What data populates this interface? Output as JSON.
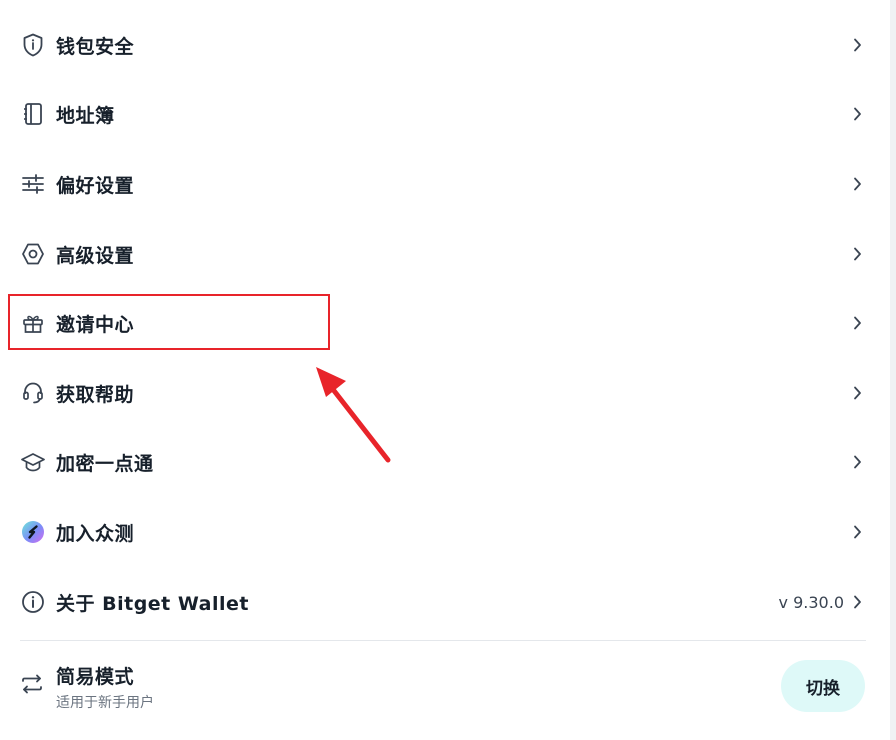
{
  "menu": {
    "items": [
      {
        "label": "钱包安全",
        "icon": "shield-icon"
      },
      {
        "label": "地址簿",
        "icon": "address-book-icon"
      },
      {
        "label": "偏好设置",
        "icon": "sliders-icon"
      },
      {
        "label": "高级设置",
        "icon": "hexagon-gear-icon"
      },
      {
        "label": "邀请中心",
        "icon": "gift-icon"
      },
      {
        "label": "获取帮助",
        "icon": "headset-icon"
      },
      {
        "label": "加密一点通",
        "icon": "graduation-cap-icon"
      },
      {
        "label": "加入众测",
        "icon": "beta-logo-icon"
      },
      {
        "label": "关于 Bitget Wallet",
        "icon": "info-icon",
        "value": "v 9.30.0"
      }
    ]
  },
  "mode": {
    "title": "简易模式",
    "subtitle": "适用于新手用户",
    "switch_label": "切换",
    "icon": "swap-arrows-icon"
  },
  "colors": {
    "text": "#17202b",
    "secondary": "#6b7480",
    "switch_bg": "#def9f8",
    "annotation": "#e8242a"
  }
}
